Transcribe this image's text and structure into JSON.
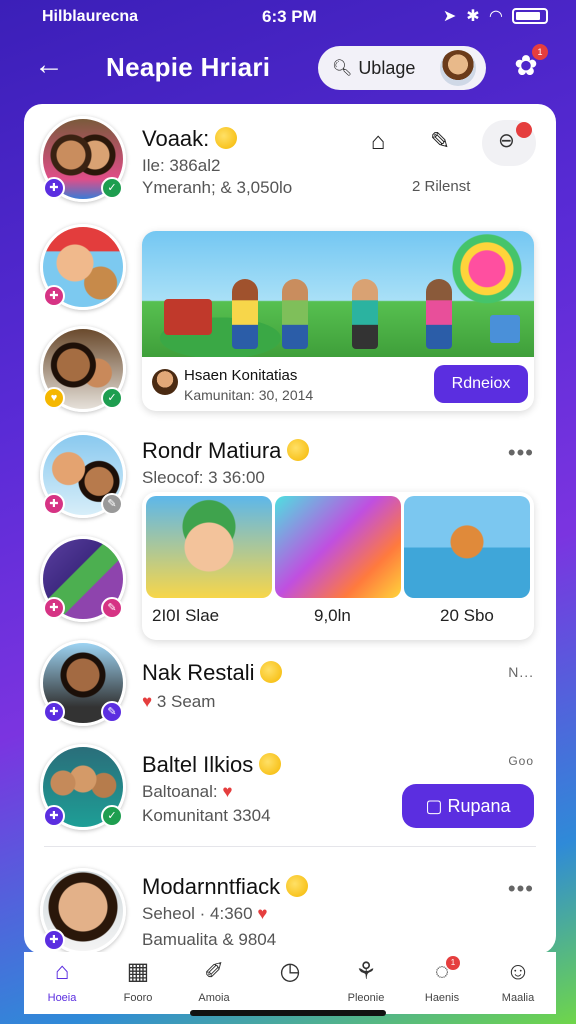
{
  "status": {
    "left": "Hilblaurecna",
    "time": "6:3 PM"
  },
  "header": {
    "title": "Neapie Hriari",
    "search_text": "Ublage"
  },
  "feed": [
    {
      "name": "Voaak:",
      "line1": "Ile: 386al2",
      "line2": "Ymeranh; & 3,050lo",
      "right_text": "2 Rilenst"
    },
    {
      "promo_title": "Hsaen Konitatias",
      "promo_sub": "Kamunitan: 30, 2014",
      "promo_cta": "Rdneiox"
    },
    {
      "name": "Rondr Matiura",
      "line1": "Sleocof: 3 36:00",
      "thumbs": [
        "2I0I Slae",
        "9,0ln",
        "20 Sbo"
      ]
    },
    {
      "name": "Nak Restali",
      "line1": "3 Seam",
      "right_text": "N..."
    },
    {
      "name": "Baltel Ilkios",
      "line1": "Baltoanal:",
      "line2": "Komunitant 3304",
      "cta": "Rupana",
      "right_text": "Goo"
    },
    {
      "name": "Modarnntfiack",
      "line1": "Seheol · 4:360",
      "line2": "Bamualita & 9804"
    }
  ],
  "nav": [
    {
      "label": "Hoeia"
    },
    {
      "label": "Fooro"
    },
    {
      "label": "Amoia"
    },
    {
      "label": ""
    },
    {
      "label": "Pleonie"
    },
    {
      "label": "Haenis"
    },
    {
      "label": "Maalia"
    }
  ]
}
